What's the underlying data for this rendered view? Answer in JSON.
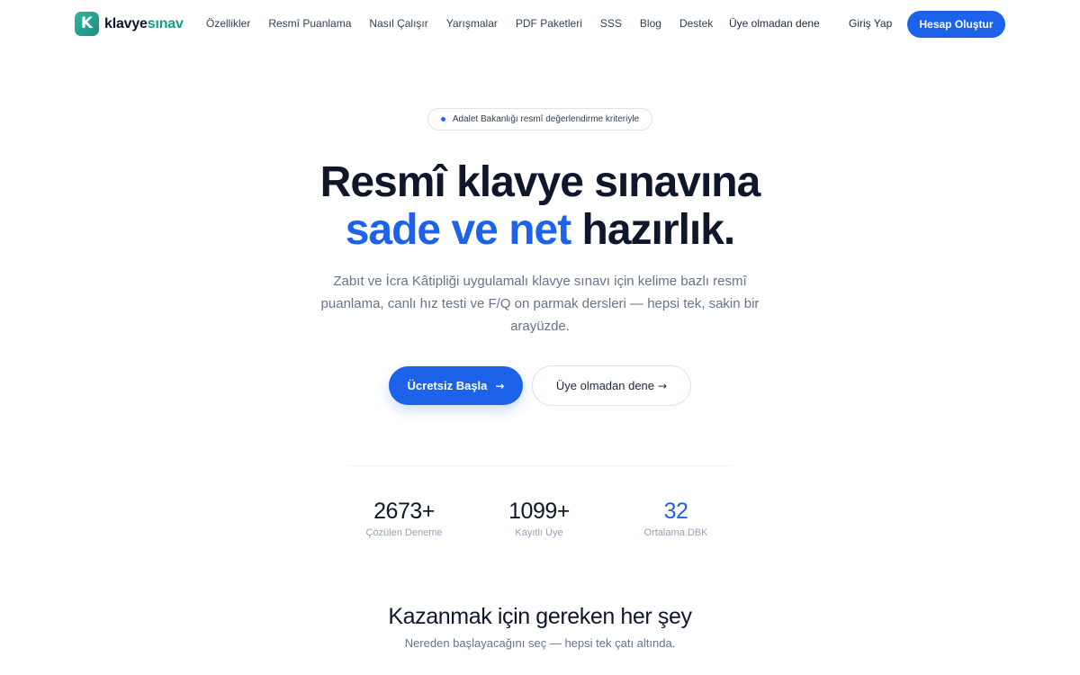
{
  "brand": {
    "logo_letter": "K",
    "name_part1": "klavye",
    "name_part2": "sınav"
  },
  "nav": {
    "links": [
      "Özellikler",
      "Resmî Puanlama",
      "Nasıl Çalışır",
      "Yarışmalar",
      "PDF Paketleri",
      "SSS",
      "Blog",
      "Destek"
    ],
    "try_label": "Üye olmadan dene",
    "login_label": "Giriş Yap",
    "signup_label": "Hesap Oluştur"
  },
  "badge": {
    "text": "Adalet Bakanlığı resmî değerlendirme kriteriyle"
  },
  "hero": {
    "title_line1": "Resmî klavye sınavına",
    "title_accent": "sade ve net",
    "title_rest": "hazırlık.",
    "subtitle": "Zabıt ve İcra Kâtipliği uygulamalı klavye sınavı için kelime bazlı resmî puanlama, canlı hız testi ve F/Q on parmak dersleri — hepsi tek, sakin bir arayüzde.",
    "primary_cta": "Ücretsiz Başla",
    "primary_arrow": "→",
    "secondary_cta": "Üye olmadan dene",
    "secondary_arrow": "→"
  },
  "stats": [
    {
      "value": "2673+",
      "label": "Çözülen Deneme"
    },
    {
      "value": "1099+",
      "label": "Kayıtlı Üye"
    },
    {
      "value": "32",
      "label": "Ortalama DBK"
    }
  ],
  "section": {
    "title": "Kazanmak için gereken her şey",
    "subtitle": "Nereden başlayacağını seç — hepsi tek çatı altında."
  },
  "colors": {
    "accent": "#1d63ea",
    "brand_green": "#179c7e",
    "muted": "#64748b"
  }
}
